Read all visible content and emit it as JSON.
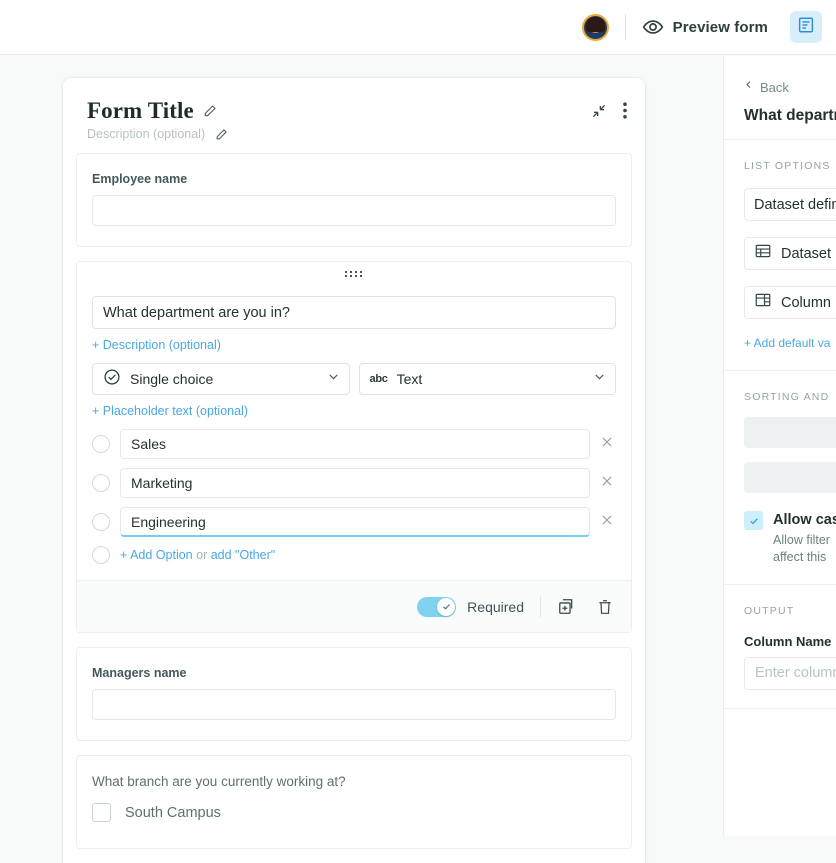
{
  "topbar": {
    "preview_label": "Preview form",
    "avatar_name": "user-avatar",
    "eye_icon": "eye-icon",
    "doc_icon": "form-document-icon"
  },
  "form": {
    "title": "Form Title",
    "description_placeholder": "Description (optional)",
    "collapse_icon": "collapse-arrows-icon",
    "menu_icon": "more-vertical-icon"
  },
  "questions": [
    {
      "label": "Employee name",
      "value": ""
    }
  ],
  "active_question": {
    "title": "What department are you in?",
    "description_link": "+ Description (optional)",
    "placeholder_link": "+ Placeholder text (optional)",
    "type_select": {
      "value": "Single choice",
      "icon": "check-circle-icon"
    },
    "format_select": {
      "value": "Text",
      "icon": "abc-icon"
    },
    "options": [
      {
        "value": "Sales",
        "focused": false
      },
      {
        "value": "Marketing",
        "focused": false
      },
      {
        "value": "Engineering",
        "focused": true
      }
    ],
    "add_option_label": "+ Add Option",
    "add_option_or": " or ",
    "add_other_label": "add \"Other\"",
    "footer": {
      "required_label": "Required",
      "required_on": true,
      "duplicate_icon": "duplicate-icon",
      "delete_icon": "trash-icon"
    }
  },
  "questions_after": [
    {
      "label": "Managers name",
      "value": ""
    }
  ],
  "checkbox_question": {
    "label": "What branch are you currently working at?",
    "options": [
      {
        "label": "South Campus",
        "checked": false
      }
    ]
  },
  "side_panel": {
    "back_label": "Back",
    "question_title": "What departm",
    "list_options": {
      "section_title": "LIST OPTIONS",
      "fields": [
        {
          "value": "Dataset defin",
          "icon": ""
        },
        {
          "value": "Dataset",
          "icon": "table-icon"
        },
        {
          "value": "Column",
          "icon": "column-icon"
        }
      ],
      "add_default_link": "+ Add default va"
    },
    "sorting": {
      "section_title": "SORTING AND",
      "allow_case_title": "Allow cas",
      "allow_case_desc_line1": "Allow filter",
      "allow_case_desc_line2": "affect this",
      "allow_case_checked": true
    },
    "output": {
      "section_title": "OUTPUT",
      "column_name_label": "Column Name",
      "column_name_placeholder": "Enter column"
    }
  },
  "colors": {
    "accent_blue": "#4aa8e0",
    "toggle_blue": "#7fd3ef",
    "checkbox_blue": "#cdeefb",
    "page_bg": "#f8faf9"
  }
}
